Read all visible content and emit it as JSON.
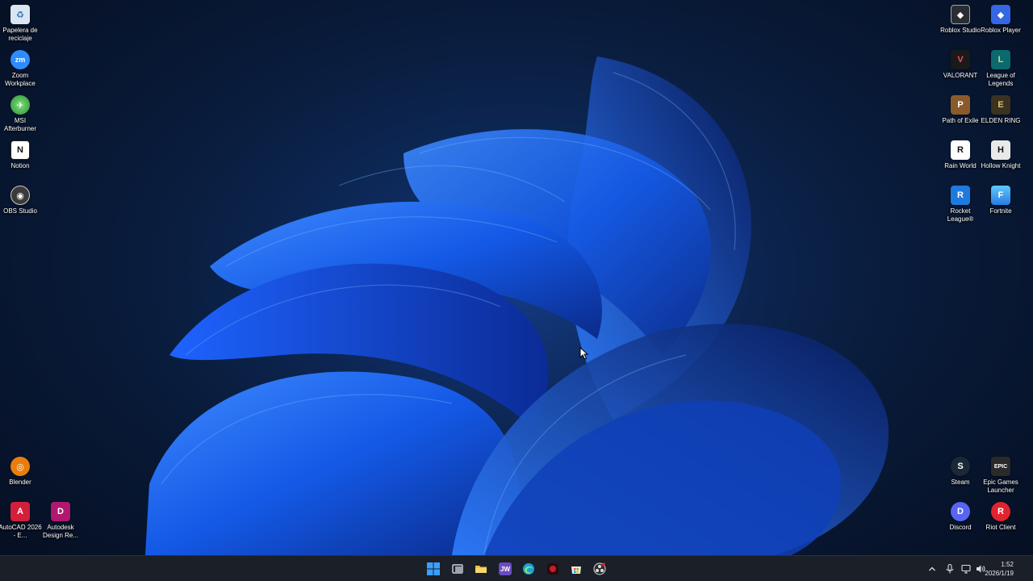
{
  "desktop": {
    "left_icons": [
      {
        "label": "Papelera de reciclaje",
        "icon": "recycle-bin-icon",
        "color": "#d9e6f2",
        "glyph": "♻"
      },
      {
        "label": "Zoom Workplace",
        "icon": "zoom-icon",
        "color": "#2d8cff",
        "glyph": "zm"
      },
      {
        "label": "MSI Afterburner",
        "icon": "msi-afterburner-icon",
        "color": "#3aa34a",
        "glyph": "✈"
      },
      {
        "label": "Notion",
        "icon": "notion-icon",
        "color": "#ffffff",
        "glyph": "N"
      },
      {
        "label": "OBS Studio",
        "icon": "obs-icon",
        "color": "#3a3a3a",
        "glyph": "◉"
      },
      {
        "label": "Blender",
        "icon": "blender-icon",
        "color": "#e87d0d",
        "glyph": "◎"
      },
      {
        "label": "AutoCAD 2026 - E...",
        "icon": "autocad-icon",
        "color": "#d21f3c",
        "glyph": "A"
      },
      {
        "label": "Autodesk Design Re...",
        "icon": "autodesk-design-review-icon",
        "color": "#b0176e",
        "glyph": "D"
      }
    ],
    "right_icons": [
      {
        "label": "Roblox Studio",
        "icon": "roblox-studio-icon",
        "color": "#2a2d33",
        "glyph": "◆"
      },
      {
        "label": "Roblox Player",
        "icon": "roblox-player-icon",
        "color": "#3566e3",
        "glyph": "◆"
      },
      {
        "label": "VALORANT",
        "icon": "valorant-icon",
        "color": "#ff4655",
        "glyph": "V"
      },
      {
        "label": "League of Legends",
        "icon": "league-of-legends-icon",
        "color": "#0b6a6f",
        "glyph": "L"
      },
      {
        "label": "Path of Exile",
        "icon": "path-of-exile-icon",
        "color": "#8b5a2b",
        "glyph": "P"
      },
      {
        "label": "ELDEN RING",
        "icon": "elden-ring-icon",
        "color": "#b59a52",
        "glyph": "E"
      },
      {
        "label": "Rain World",
        "icon": "rain-world-icon",
        "color": "#ffffff",
        "glyph": "R"
      },
      {
        "label": "Hollow Knight",
        "icon": "hollow-knight-icon",
        "color": "#e9e9e9",
        "glyph": "H"
      },
      {
        "label": "Rocket League®",
        "icon": "rocket-league-icon",
        "color": "#1f7ae0",
        "glyph": "R"
      },
      {
        "label": "Fortnite",
        "icon": "fortnite-icon",
        "color": "#3fb0f5",
        "glyph": "F"
      },
      {
        "label": "Steam",
        "icon": "steam-icon",
        "color": "#1b2838",
        "glyph": "S"
      },
      {
        "label": "Epic Games Launcher",
        "icon": "epic-games-icon",
        "color": "#2a2a2a",
        "glyph": "EPIC"
      },
      {
        "label": "Discord",
        "icon": "discord-icon",
        "color": "#5865f2",
        "glyph": "D"
      },
      {
        "label": "Riot Client",
        "icon": "riot-client-icon",
        "color": "#e0242f",
        "glyph": "R"
      }
    ]
  },
  "taskbar": {
    "pinned": [
      {
        "name": "start-button",
        "icon": "windows-start-icon",
        "color": "#3aa0ff",
        "glyph": ""
      },
      {
        "name": "task-view-button",
        "icon": "task-view-icon",
        "color": "#cfd6e0",
        "glyph": ""
      },
      {
        "name": "file-explorer-button",
        "icon": "folder-icon",
        "color": "#f3c03a",
        "glyph": ""
      },
      {
        "name": "jw-app-button",
        "icon": "jw-icon",
        "color": "#6b4bbf",
        "glyph": "JW"
      },
      {
        "name": "edge-button",
        "icon": "edge-icon",
        "color": "#1aa0d8",
        "glyph": ""
      },
      {
        "name": "record-app-button",
        "icon": "record-icon",
        "color": "#c61f2a",
        "glyph": ""
      },
      {
        "name": "store-button",
        "icon": "store-icon",
        "color": "#e8e8e8",
        "glyph": ""
      },
      {
        "name": "obs-taskbar-button",
        "icon": "obs-icon",
        "color": "#3a3a3a",
        "glyph": ""
      }
    ],
    "tray": {
      "chevron": "chevron-up-icon",
      "mic": "microphone-icon",
      "network": "network-icon",
      "volume": "volume-icon"
    },
    "time": "1:52",
    "date": "2026/1/19"
  }
}
